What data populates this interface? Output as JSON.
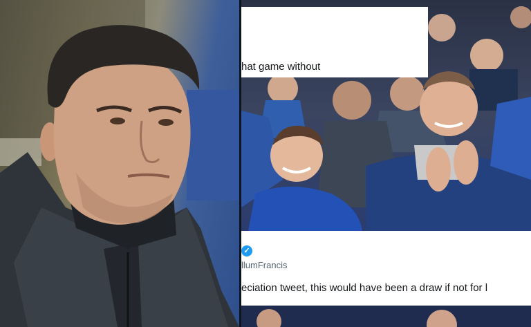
{
  "left_photo": {
    "subject": "man-portrait"
  },
  "right_photo": {
    "subject": "crowd-in-stands"
  },
  "tweet_top": {
    "text": "hat game without"
  },
  "tweet_bottom": {
    "verified_glyph": "✓",
    "handle": "llumFrancis",
    "text": "eciation tweet, this would have been a draw if not for l"
  },
  "colors": {
    "verified_blue": "#1d9bf0",
    "card_bg": "#ffffff",
    "text": "#14171a",
    "handle": "#536471"
  }
}
